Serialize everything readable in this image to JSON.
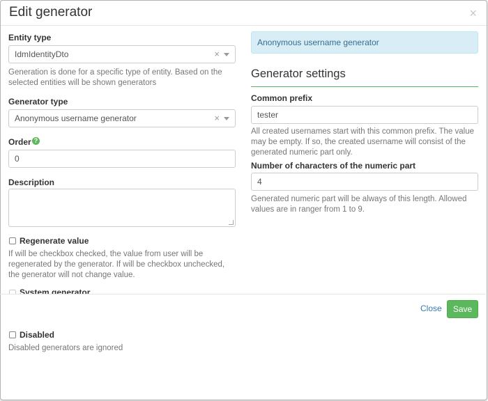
{
  "dialog": {
    "title": "Edit generator",
    "close_icon": "×"
  },
  "left": {
    "entity_type": {
      "label": "Entity type",
      "value": "IdmIdentityDto",
      "clear": "×",
      "help": [
        "Generation is done for a specific type of entity. Based on the",
        "selected entities will be shown generators"
      ]
    },
    "generator_type": {
      "label": "Generator type",
      "value": "Anonymous username generator",
      "clear": "×"
    },
    "order": {
      "label": "Order",
      "help_icon": "?",
      "value": "0"
    },
    "description": {
      "label": "Description",
      "value": ""
    },
    "regenerate": {
      "label": "Regenerate value",
      "checked": false,
      "help": [
        "If will be checkbox checked, the value from user will be",
        "regenerated by the generator. If will be checkbox unchecked,",
        "the generator will not change value."
      ]
    },
    "system_generator": {
      "label": "System generator",
      "checked": false
    },
    "disabled": {
      "label": "Disabled",
      "checked": false,
      "help": "Disabled generators are ignored"
    }
  },
  "right": {
    "info": "Anonymous username generator",
    "settings_title": "Generator settings",
    "common_prefix": {
      "label": "Common prefix",
      "value": "tester",
      "help": [
        "All created usernames start with this common prefix. The value",
        "may be empty. If so, the created username will consist of the",
        "generated numeric part only."
      ]
    },
    "numeric_part": {
      "label": "Number of characters of the numeric part",
      "value": "4",
      "help": [
        "Generated numeric part will be always of this length. Allowed",
        "values are in ranger from 1 to 9."
      ]
    }
  },
  "footer": {
    "close_label": "Close",
    "save_label": "Save"
  },
  "colors": {
    "accent_green": "#5cb85c",
    "info_bg": "#d9edf7",
    "link_blue": "#337ab7"
  }
}
